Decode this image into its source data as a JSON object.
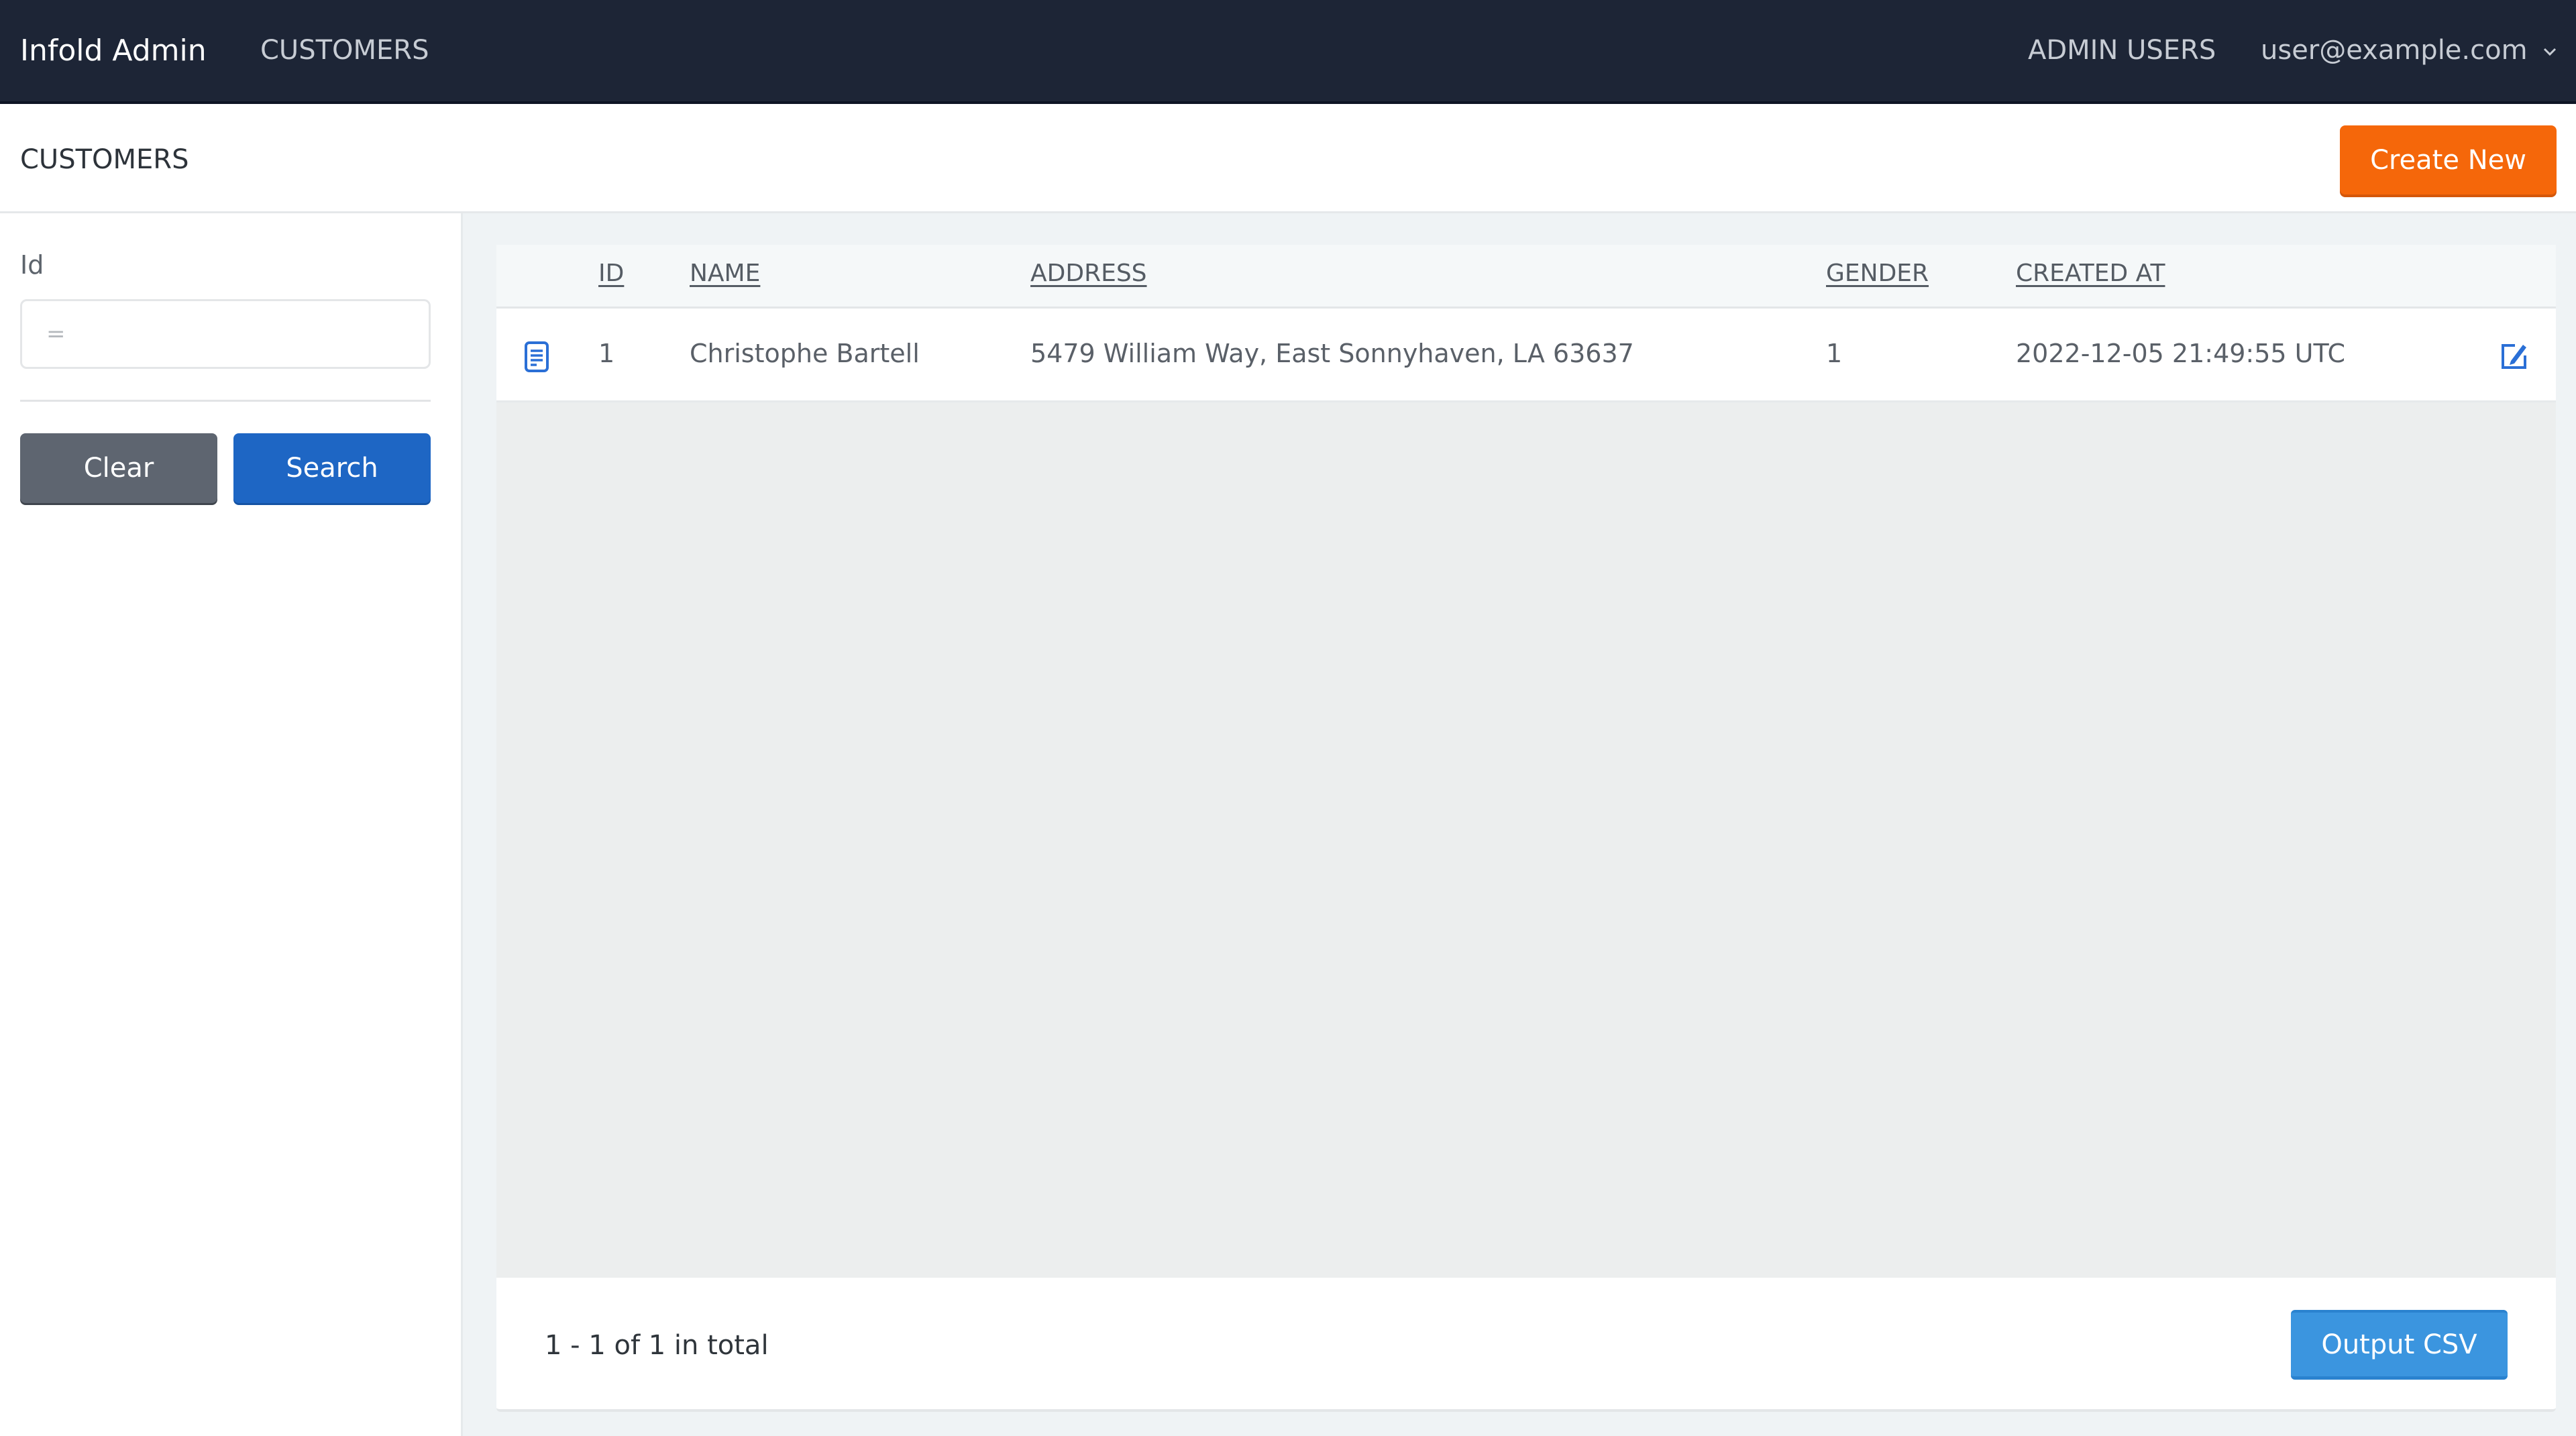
{
  "navbar": {
    "brand": "Infold Admin",
    "links": [
      {
        "label": "CUSTOMERS"
      },
      {
        "label": "ADMIN USERS"
      }
    ],
    "user_menu": {
      "label": "user@example.com",
      "icon": "chevron-down-icon"
    }
  },
  "page_header": {
    "title": "CUSTOMERS",
    "create_button": "Create New",
    "create_button_color": "#f5670a"
  },
  "sidebar": {
    "filters": [
      {
        "label": "Id",
        "value": "",
        "placeholder": "="
      }
    ],
    "clear_button": "Clear",
    "search_button": "Search"
  },
  "table": {
    "columns": [
      "ID",
      "NAME",
      "ADDRESS",
      "GENDER",
      "CREATED AT"
    ],
    "rows": [
      {
        "id": "1",
        "name": "Christophe Bartell",
        "address": "5479 William Way, East Sonnyhaven, LA 63637",
        "gender": "1",
        "created_at": "2022-12-05 21:49:55 UTC",
        "row_icons": [
          "document-icon",
          "edit-icon"
        ]
      }
    ]
  },
  "footer": {
    "pagination_text": "1 - 1 of 1 in total",
    "csv_button": "Output CSV"
  },
  "colors": {
    "navbar_bg": "#1d2536",
    "primary": "#1e66c4",
    "secondary": "#5e6570",
    "accent": "#f5670a",
    "info": "#3b95df",
    "icon_blue": "#2a6fd6"
  }
}
